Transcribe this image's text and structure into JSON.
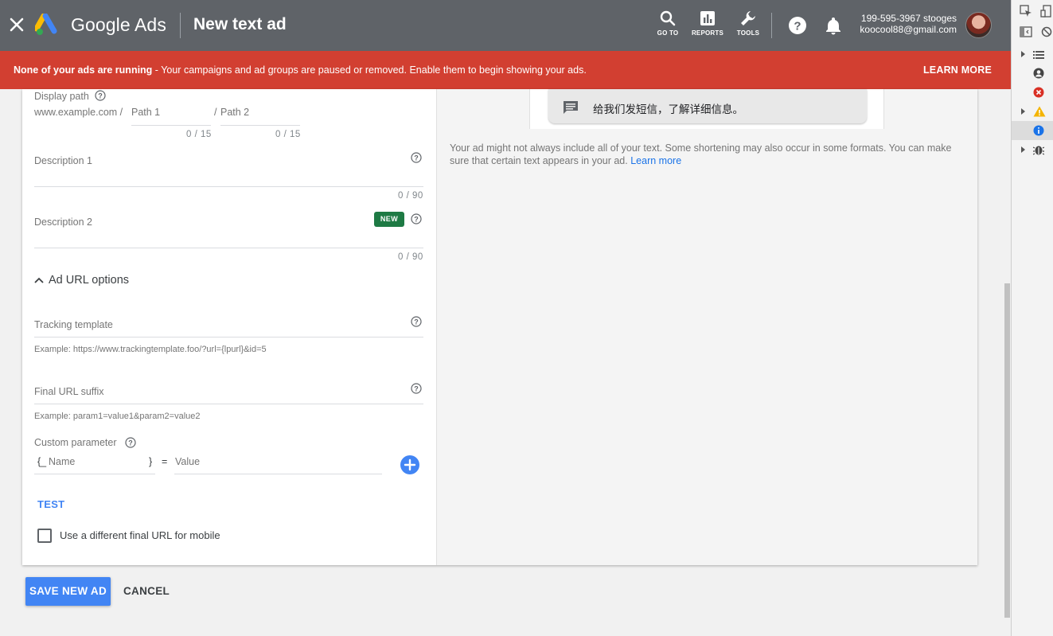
{
  "header": {
    "brand": "Google Ads",
    "page_title": "New text ad",
    "tools": [
      {
        "label": "GO TO",
        "icon": "search-icon"
      },
      {
        "label": "REPORTS",
        "icon": "bar-chart-icon"
      },
      {
        "label": "TOOLS",
        "icon": "wrench-icon"
      }
    ],
    "account_id": "199-595-3967 stooges",
    "account_email": "koocool88@gmail.com"
  },
  "alert": {
    "bold": "None of your ads are running",
    "text": " - Your campaigns and ad groups are paused or removed. Enable them to begin showing your ads.",
    "action": "LEARN MORE"
  },
  "form": {
    "display_path": {
      "label": "Display path",
      "domain": "www.example.com /",
      "path1_placeholder": "Path 1",
      "path1_counter": "0 / 15",
      "sep": "/",
      "path2_placeholder": "Path 2",
      "path2_counter": "0 / 15"
    },
    "description1": {
      "label": "Description 1",
      "counter": "0 / 90"
    },
    "description2": {
      "label": "Description 2",
      "badge": "NEW",
      "counter": "0 / 90"
    },
    "url_options": {
      "title": "Ad URL options",
      "tracking_label": "Tracking template",
      "tracking_hint": "Example: https://www.trackingtemplate.foo/?url={lpurl}&id=5",
      "suffix_label": "Final URL suffix",
      "suffix_hint": "Example: param1=value1&param2=value2",
      "custom_label": "Custom parameter",
      "open_brace": "{_",
      "name_placeholder": "Name",
      "close_brace": "}",
      "equals": "=",
      "value_placeholder": "Value",
      "test": "TEST",
      "mobile_label": "Use a different final URL for mobile"
    }
  },
  "preview": {
    "sms_text": "给我们发短信，了解详细信息。",
    "note": "Your ad might not always include all of your text. Some shortening may also occur in some formats. You can make sure that certain text appears in your ad.",
    "note_link": "Learn more"
  },
  "actions": {
    "save": "SAVE NEW AD",
    "cancel": "CANCEL"
  },
  "colors": {
    "topbar": "#5f6368",
    "alert": "#d23f31",
    "accent": "#4285f4",
    "badge": "#1e7a44"
  }
}
